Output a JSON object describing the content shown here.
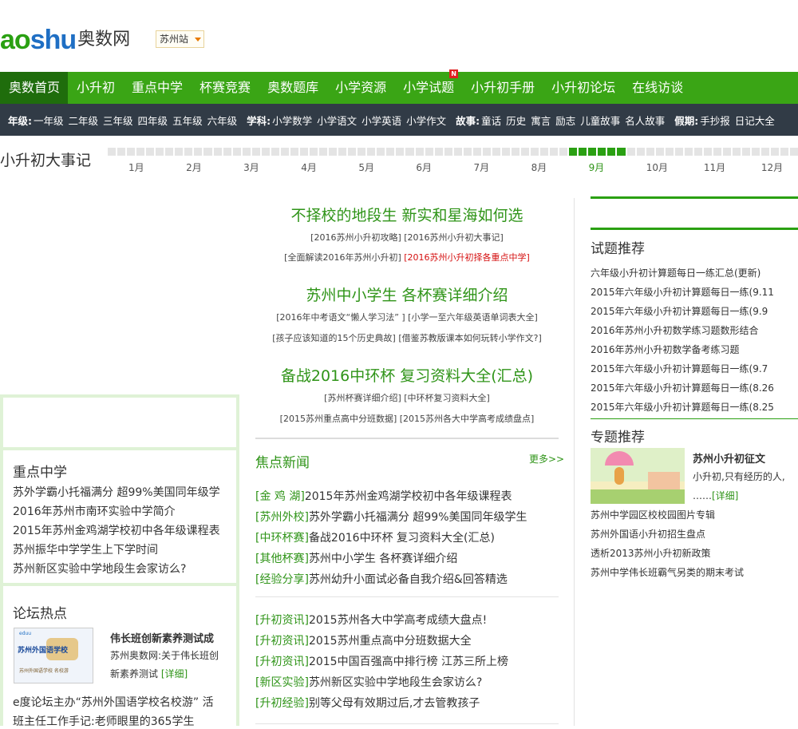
{
  "header": {
    "logo_en_a": "ao",
    "logo_en_b": "shu",
    "logo_cn": "奥数网",
    "city": "苏州站"
  },
  "nav": [
    {
      "label": "奥数首页",
      "active": true
    },
    {
      "label": "小升初"
    },
    {
      "label": "重点中学"
    },
    {
      "label": "杯赛竞赛"
    },
    {
      "label": "奥数题库"
    },
    {
      "label": "小学资源"
    },
    {
      "label": "小学试题",
      "badge": "N"
    },
    {
      "label": "小升初手册"
    },
    {
      "label": "小升初论坛"
    },
    {
      "label": "在线访谈"
    }
  ],
  "subnav": {
    "grade_label": "年级:",
    "grades": [
      "一年级",
      "二年级",
      "三年级",
      "四年级",
      "五年级",
      "六年级"
    ],
    "subject_label": "学科:",
    "subjects": [
      "小学数学",
      "小学语文",
      "小学英语",
      "小学作文"
    ],
    "story_label": "故事:",
    "stories": [
      "童话",
      "历史",
      "寓言",
      "励志",
      "儿童故事",
      "名人故事"
    ],
    "holiday_label": "假期:",
    "holidays": [
      "手抄报",
      "日记大全"
    ]
  },
  "timeline": {
    "title": "小升初大事记",
    "months": [
      "1月",
      "2月",
      "3月",
      "4月",
      "5月",
      "6月",
      "7月",
      "8月",
      "9月",
      "10月",
      "11月",
      "12月"
    ],
    "current_month": "9月"
  },
  "center": {
    "headline1": "不择校的地段生 新实和星海如何选",
    "row1a": "[2016苏州小升初攻略] [2016苏州小升初大事记]",
    "row1b_a": "[全面解读2016年苏州小升初] ",
    "row1b_b": "[2016苏州小升初择各重点中学]",
    "headline2": "苏州中小学生 各杯赛详细介绍",
    "row2a": "[2016年中考语文“懒人学习法” ] [小学一至六年级英语单词表大全]",
    "row2b": "[孩子应该知道的15个历史典故] [借鉴苏教版课本如何玩转小学作文?]",
    "headline3": "备战2016中环杯 复习资料大全(汇总)",
    "row3a": "[苏州杯赛详细介绍] [中环杯复习资料大全]",
    "row3b": "[2015苏州重点高中分班数据] [2015苏州各大中学高考成绩盘点]",
    "focus_title": "焦点新闻",
    "focus_more": "更多>>",
    "news1": [
      {
        "tag": "[金 鸡 湖]",
        "text": "2015年苏州金鸡湖学校初中各年级课程表"
      },
      {
        "tag": "[苏州外校]",
        "text": "苏外学霸小托福满分 超99%美国同年级学生"
      },
      {
        "tag": "[中环杯赛]",
        "text": "备战2016中环杯 复习资料大全(汇总)"
      },
      {
        "tag": "[其他杯赛]",
        "text": "苏州中小学生 各杯赛详细介绍"
      },
      {
        "tag": "[经验分享]",
        "text": "苏州幼升小面试必备自我介绍&回答精选"
      }
    ],
    "news2": [
      {
        "tag": "[升初资讯]",
        "text": "2015苏州各大中学高考成绩大盘点!"
      },
      {
        "tag": "[升初资讯]",
        "text": "2015苏州重点高中分班数据大全"
      },
      {
        "tag": "[升初资讯]",
        "text": "2015中国百强高中排行榜 江苏三所上榜"
      },
      {
        "tag": "[新区实验]",
        "text": "苏州新区实验中学地段生会家访么?"
      },
      {
        "tag": "[升初经验]",
        "text": "别等父母有效期过后,才去管教孩子"
      }
    ]
  },
  "left": {
    "key_title": "重点中学",
    "key_items": [
      "苏外学霸小托福满分 超99%美国同年级学",
      "2016年苏州市南环实验中学简介",
      "2015年苏州金鸡湖学校初中各年级课程表",
      "苏州振华中学学生上下学时间",
      "苏州新区实验中学地段生会家访么?"
    ],
    "forum_title": "论坛热点",
    "forum_thumb_brand": "eduu",
    "forum_thumb_caption": "苏州外国语学校",
    "forum_thumb_sub": "苏州外国语学校 名校游",
    "forum_pic_title": "伟长班创新素养测试成",
    "forum_pic_desc1": "苏州奥数网:关于伟长班创",
    "forum_pic_desc2": "新素养测试 ",
    "forum_pic_more": "[详细]",
    "forum_line1": "e度论坛主办“苏州外国语学校名校游” 活",
    "forum_line2": "班主任工作手记:老师眼里的365学生"
  },
  "right": {
    "test_title": "试题推荐",
    "test_items": [
      "六年级小升初计算题每日一练汇总(更新)",
      "2015年六年级小升初计算题每日一练(9.11",
      "2015年六年级小升初计算题每日一练(9.9",
      "2016年苏州小升初数学练习题数形结合",
      "2016年苏州小升初数学备考练习题",
      "2015年六年级小升初计算题每日一练(9.7",
      "2015年六年级小升初计算题每日一练(8.26",
      "2015年六年级小升初计算题每日一练(8.25"
    ],
    "topic_title": "专题推荐",
    "topic_name": "苏州小升初征文",
    "topic_desc": "小升初,只有经历的人,",
    "topic_more_a": "……",
    "topic_more_b": "[详细]",
    "topic_items": [
      "苏州中学园区校校园图片专辑",
      "苏州外国语小升初招生盘点",
      "透析2013苏州小升初新政策",
      "苏州中学伟长班霸气另类的期末考试"
    ]
  }
}
